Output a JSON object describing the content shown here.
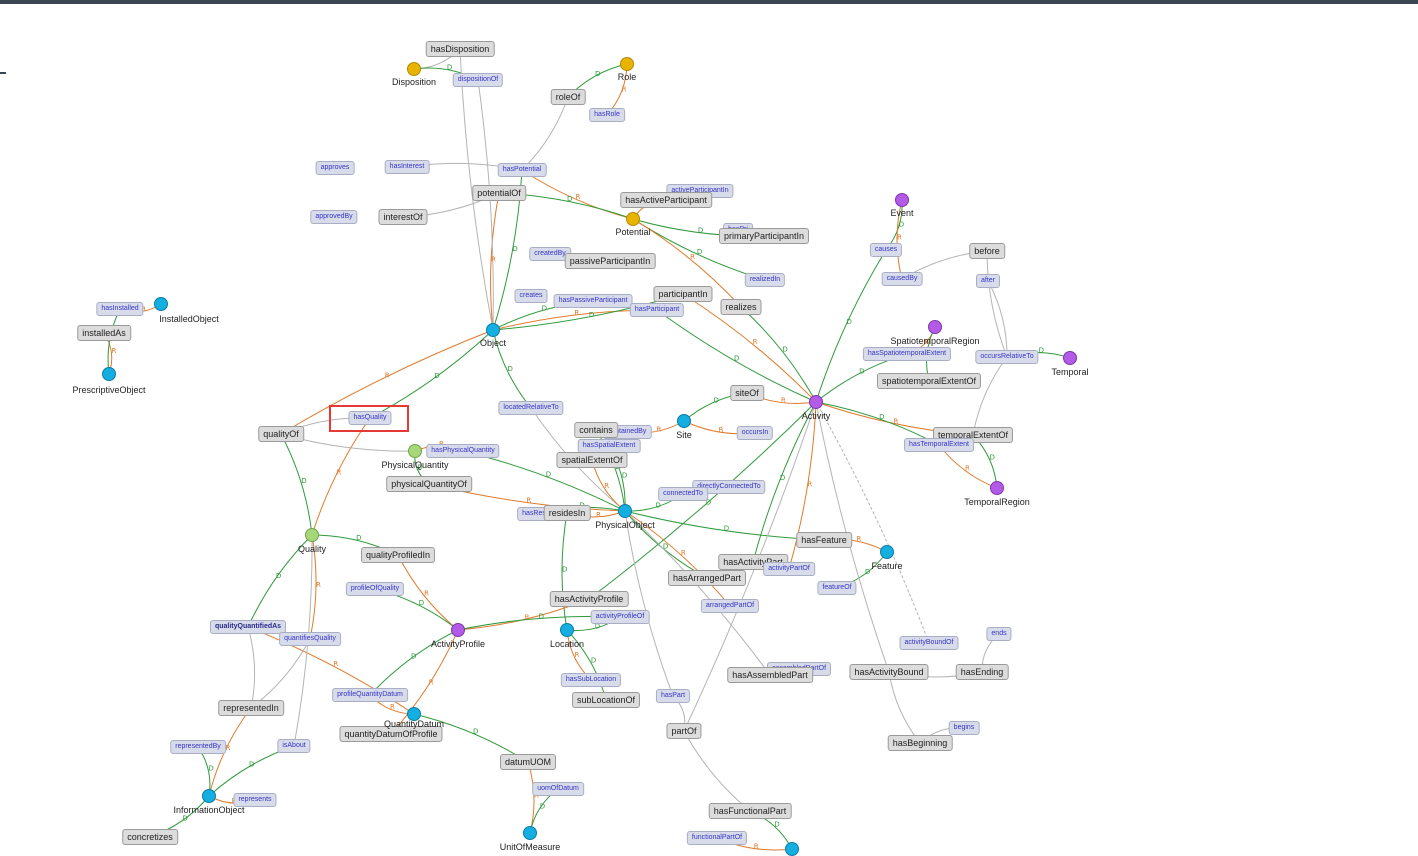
{
  "diagram": {
    "classes": [
      {
        "id": "Disposition",
        "label": "Disposition",
        "color": "#e8b400"
      },
      {
        "id": "Role",
        "label": "Role",
        "color": "#e8b400"
      },
      {
        "id": "Potential",
        "label": "Potential",
        "color": "#e8b400"
      },
      {
        "id": "InstalledObject",
        "label": "InstalledObject",
        "color": "#14aee0"
      },
      {
        "id": "PrescriptiveObject",
        "label": "PrescriptiveObject",
        "color": "#14aee0"
      },
      {
        "id": "Object",
        "label": "Object",
        "color": "#14aee0"
      },
      {
        "id": "Event",
        "label": "Event",
        "color": "#b35ae6"
      },
      {
        "id": "SpatiotemporalRegion",
        "label": "SpatiotemporalRegion",
        "color": "#b35ae6"
      },
      {
        "id": "Temporal",
        "label": "Temporal",
        "color": "#b35ae6"
      },
      {
        "id": "Activity",
        "label": "Activity",
        "color": "#b35ae6"
      },
      {
        "id": "Site",
        "label": "Site",
        "color": "#14aee0"
      },
      {
        "id": "PhysicalQuantity",
        "label": "PhysicalQuantity",
        "color": "#a6d87a"
      },
      {
        "id": "TemporalRegion",
        "label": "TemporalRegion",
        "color": "#b35ae6"
      },
      {
        "id": "PhysicalObject",
        "label": "PhysicalObject",
        "color": "#14aee0"
      },
      {
        "id": "Quality",
        "label": "Quality",
        "color": "#a6d87a"
      },
      {
        "id": "Feature",
        "label": "Feature",
        "color": "#14aee0"
      },
      {
        "id": "ActivityProfile",
        "label": "ActivityProfile",
        "color": "#b35ae6"
      },
      {
        "id": "Location",
        "label": "Location",
        "color": "#14aee0"
      },
      {
        "id": "QuantityDatum",
        "label": "QuantityDatum",
        "color": "#14aee0"
      },
      {
        "id": "InformationObject",
        "label": "InformationObject",
        "color": "#14aee0"
      },
      {
        "id": "UnitOfMeasure",
        "label": "UnitOfMeasure",
        "color": "#14aee0"
      },
      {
        "id": "Partial",
        "label": "",
        "color": "#14aee0"
      }
    ],
    "properties": [
      {
        "label": "hasDisposition",
        "style": "prop"
      },
      {
        "label": "dispositionOf",
        "style": "inv"
      },
      {
        "label": "roleOf",
        "style": "prop"
      },
      {
        "label": "hasRole",
        "style": "inv"
      },
      {
        "label": "approves",
        "style": "inv"
      },
      {
        "label": "hasInterest",
        "style": "inv"
      },
      {
        "label": "hasPotential",
        "style": "inv"
      },
      {
        "label": "approvedBy",
        "style": "inv"
      },
      {
        "label": "interestOf",
        "style": "prop"
      },
      {
        "label": "potentialOf",
        "style": "prop"
      },
      {
        "label": "activeParticipantIn",
        "style": "inv"
      },
      {
        "label": "hasActiveParticipant",
        "style": "prop"
      },
      {
        "label": "hasPri",
        "style": "inv"
      },
      {
        "label": "primaryParticipantIn",
        "style": "prop"
      },
      {
        "label": "createdBy",
        "style": "inv"
      },
      {
        "label": "passiveParticipantIn",
        "style": "prop"
      },
      {
        "label": "participantIn",
        "style": "prop"
      },
      {
        "label": "creates",
        "style": "inv"
      },
      {
        "label": "hasPassiveParticipant",
        "style": "inv"
      },
      {
        "label": "hasParticipant",
        "style": "inv"
      },
      {
        "label": "realizedIn",
        "style": "inv"
      },
      {
        "label": "realizes",
        "style": "prop"
      },
      {
        "label": "causes",
        "style": "inv"
      },
      {
        "label": "before",
        "style": "prop"
      },
      {
        "label": "causedBy",
        "style": "inv"
      },
      {
        "label": "after",
        "style": "inv"
      },
      {
        "label": "hasInstalled",
        "style": "inv"
      },
      {
        "label": "installedAs",
        "style": "prop"
      },
      {
        "label": "hasSpatiotemporalExtent",
        "style": "inv"
      },
      {
        "label": "occursRelativeTo",
        "style": "inv"
      },
      {
        "label": "spatiotemporalExtentOf",
        "style": "prop"
      },
      {
        "label": "siteOf",
        "style": "prop"
      },
      {
        "label": "locatedRelativeTo",
        "style": "inv"
      },
      {
        "label": "hasQuality",
        "style": "inv"
      },
      {
        "label": "qualityOf",
        "style": "prop"
      },
      {
        "label": "containedBy",
        "style": "inv"
      },
      {
        "label": "contains",
        "style": "prop"
      },
      {
        "label": "occursIn",
        "style": "inv"
      },
      {
        "label": "temporalExtentOf",
        "style": "prop"
      },
      {
        "label": "hasSpatialExtent",
        "style": "inv"
      },
      {
        "label": "hasTemporalExtent",
        "style": "inv"
      },
      {
        "label": "hasPhysicalQuantity",
        "style": "inv"
      },
      {
        "label": "spatialExtentOf",
        "style": "prop"
      },
      {
        "label": "physicalQuantityOf",
        "style": "prop"
      },
      {
        "label": "directlyConnectedTo",
        "style": "inv"
      },
      {
        "label": "connectedTo",
        "style": "inv"
      },
      {
        "label": "hasRes",
        "style": "inv"
      },
      {
        "label": "residesIn",
        "style": "prop"
      },
      {
        "label": "hasFeature",
        "style": "prop"
      },
      {
        "label": "qualityProfiledIn",
        "style": "prop"
      },
      {
        "label": "hasActivityPart",
        "style": "prop"
      },
      {
        "label": "activityPartOf",
        "style": "inv"
      },
      {
        "label": "hasArrangedPart",
        "style": "prop"
      },
      {
        "label": "featureOf",
        "style": "inv"
      },
      {
        "label": "profileOfQuality",
        "style": "inv"
      },
      {
        "label": "hasActivityProfile",
        "style": "prop"
      },
      {
        "label": "arrangedPartOf",
        "style": "inv"
      },
      {
        "label": "qualityQuantifiedAs",
        "style": "bold"
      },
      {
        "label": "activityProfileOf",
        "style": "inv"
      },
      {
        "label": "quantifiesQuality",
        "style": "inv"
      },
      {
        "label": "activityBoundOf",
        "style": "inv"
      },
      {
        "label": "ends",
        "style": "inv"
      },
      {
        "label": "assembledPartOf",
        "style": "inv"
      },
      {
        "label": "hasAssembledPart",
        "style": "prop"
      },
      {
        "label": "hasActivityBound",
        "style": "prop"
      },
      {
        "label": "hasEnding",
        "style": "prop"
      },
      {
        "label": "hasSubLocation",
        "style": "inv"
      },
      {
        "label": "profileQuantityDatum",
        "style": "inv"
      },
      {
        "label": "hasPart",
        "style": "inv"
      },
      {
        "label": "subLocationOf",
        "style": "prop"
      },
      {
        "label": "representedIn",
        "style": "prop"
      },
      {
        "label": "quantityDatumOfProfile",
        "style": "prop"
      },
      {
        "label": "partOf",
        "style": "prop"
      },
      {
        "label": "begins",
        "style": "inv"
      },
      {
        "label": "isAbout",
        "style": "inv"
      },
      {
        "label": "hasBeginning",
        "style": "prop"
      },
      {
        "label": "representedBy",
        "style": "inv"
      },
      {
        "label": "datumUOM",
        "style": "prop"
      },
      {
        "label": "uomOfDatum",
        "style": "inv"
      },
      {
        "label": "represents",
        "style": "inv"
      },
      {
        "label": "hasFunctionalPart",
        "style": "prop"
      },
      {
        "label": "concretizes",
        "style": "prop"
      },
      {
        "label": "functionalPartOf",
        "style": "inv"
      }
    ],
    "edge_marker_labels": [
      "R",
      "D"
    ],
    "edge_colors": {
      "range": "#e07a2c",
      "domain": "#2f9a3a",
      "plain": "#b4b4b4",
      "inverse": "#6a8ad0"
    },
    "selected_property": "hasQuality"
  }
}
